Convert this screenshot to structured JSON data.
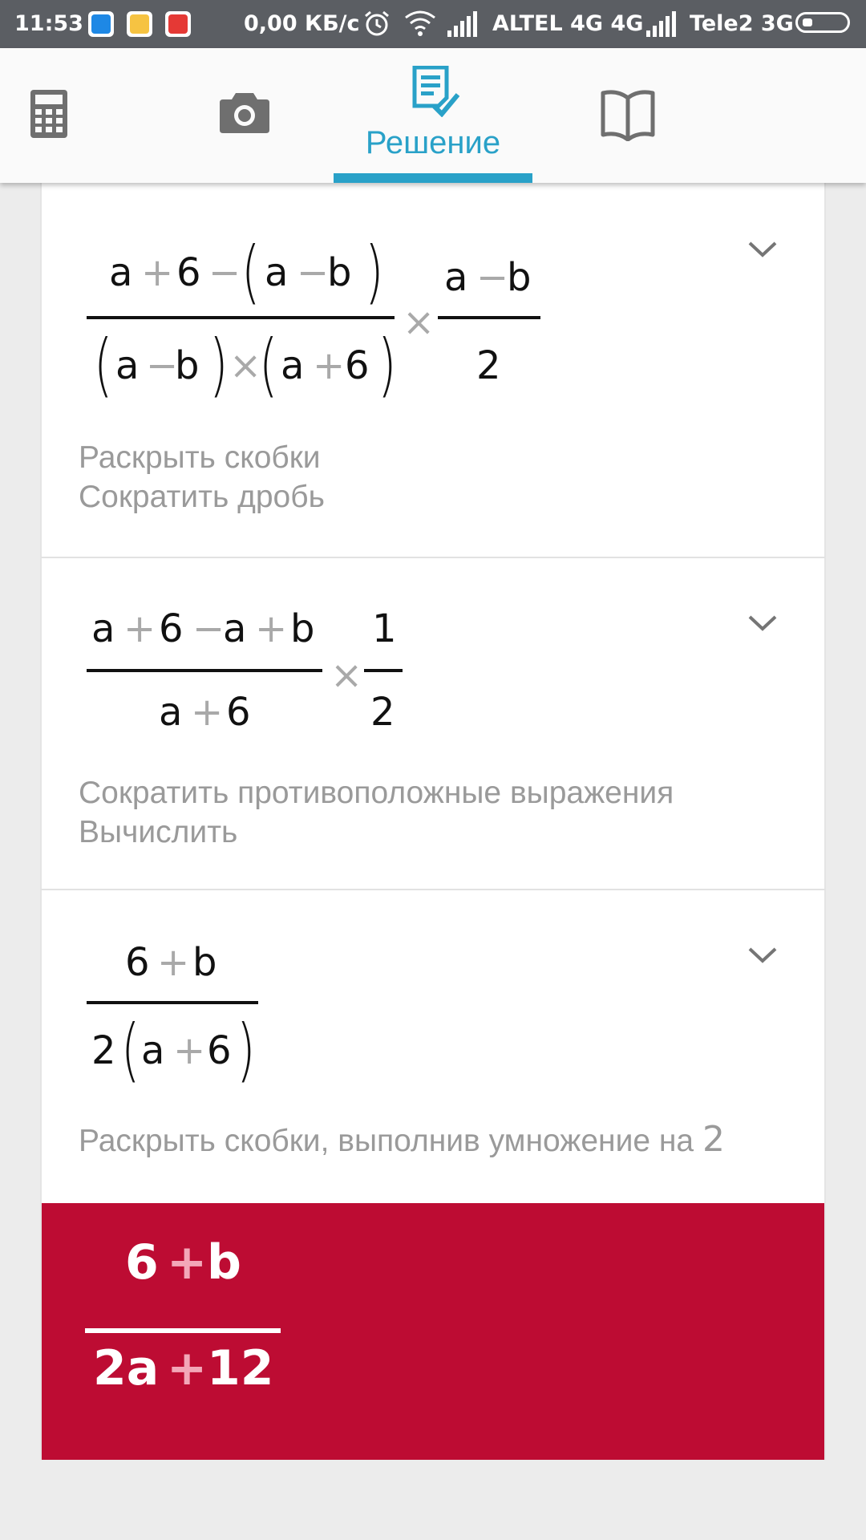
{
  "status_bar": {
    "time": "11:53",
    "network_speed": "0,00 КБ/с",
    "operator1": "ALTEL 4G 4G",
    "operator2": "Tele2 3G",
    "icons": [
      "app-icon-blue",
      "app-icon-weather",
      "yandex-icon",
      "alarm-icon",
      "wifi-icon",
      "signal-icon",
      "signal-icon",
      "battery-icon"
    ]
  },
  "tabs": {
    "calculator_icon": "calculator-icon",
    "camera_icon": "camera-icon",
    "solution_label": "Решение",
    "book_icon": "book-icon",
    "active_color": "#29a1c8"
  },
  "steps": [
    {
      "expr": {
        "num1": [
          "a",
          "+",
          "6",
          "−",
          "(",
          "a",
          "−",
          "b",
          ")"
        ],
        "den1": [
          "(",
          "a",
          "−",
          "b",
          ")",
          "×",
          "(",
          "a",
          "+",
          "6",
          ")"
        ],
        "times": "×",
        "num2": [
          "a",
          "−",
          "b"
        ],
        "den2": "2"
      },
      "desc_line1": "Раскрыть скобки",
      "desc_line2": "Сократить дробь"
    },
    {
      "expr": {
        "num1": [
          "a",
          "+",
          "6",
          "−",
          "a",
          "+",
          "b"
        ],
        "den1": [
          "a",
          "+",
          "6"
        ],
        "times": "×",
        "num2": "1",
        "den2": "2"
      },
      "desc_line1": "Сократить противоположные выражения",
      "desc_line2": "Вычислить"
    },
    {
      "expr": {
        "num": [
          "6",
          "+",
          "b"
        ],
        "den": [
          "2",
          "(",
          "a",
          "+",
          "6",
          ")"
        ]
      },
      "desc_line1": "Раскрыть скобки, выполнив умножение на",
      "desc_num": "2"
    }
  ],
  "result": {
    "num": [
      "6",
      "+",
      "b"
    ],
    "den": [
      "2a",
      "+",
      "12"
    ],
    "color": "#bd0c33"
  }
}
